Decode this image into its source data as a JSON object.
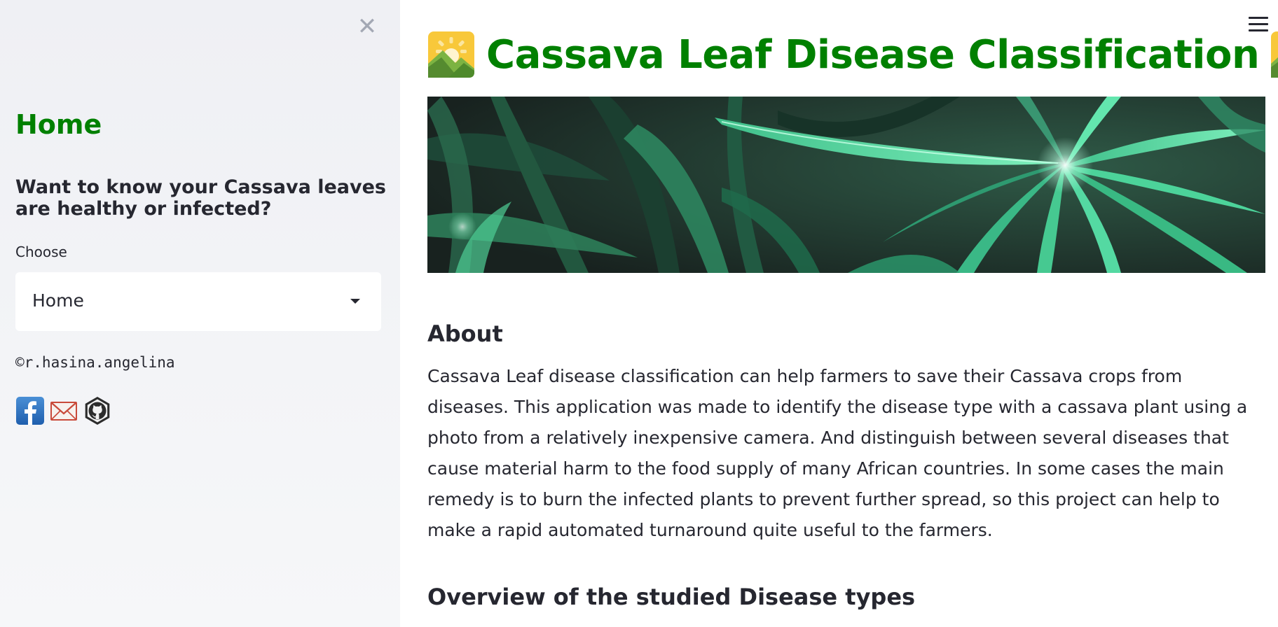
{
  "sidebar": {
    "close_icon": "close-icon",
    "home_title": "Home",
    "question": "Want to know your Cassava leaves are healthy or infected?",
    "choose_label": "Choose",
    "select": {
      "value": "Home"
    },
    "copyright": "©r.hasina.angelina",
    "social": [
      {
        "icon": "facebook-icon"
      },
      {
        "icon": "mail-icon"
      },
      {
        "icon": "github-icon"
      }
    ]
  },
  "header": {
    "menu_icon": "hamburger-icon",
    "title": "Cassava Leaf Disease Classification",
    "title_emoji": "sunrise-over-mountains-icon"
  },
  "main": {
    "banner_image": "cassava-leaves-banner",
    "about_heading": "About",
    "about_text": "Cassava Leaf disease classification can help farmers to save their Cassava crops from diseases. This application was made to identify the disease type with a cassava plant using a photo from a relatively inexpensive camera. And distinguish between several diseases that cause material harm to the food supply of many African countries. In some cases the main remedy is to burn the infected plants to prevent further spread, so this project can help to make a rapid automated turnaround quite useful to the farmers.",
    "overview_heading": "Overview of the studied Disease types"
  },
  "colors": {
    "accent": "#008000",
    "text": "#262730",
    "sidebar_bg": "#f0f2f6"
  }
}
